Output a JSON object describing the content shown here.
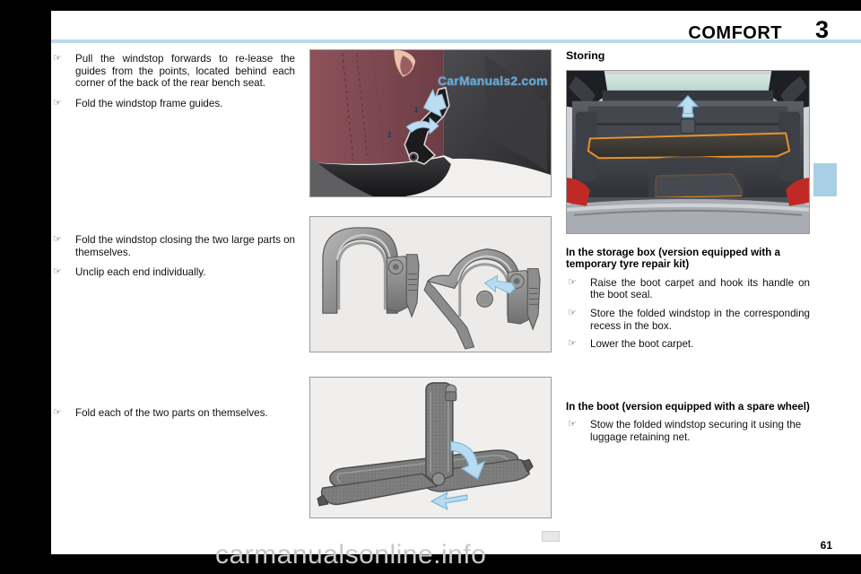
{
  "header": {
    "title": "COMFORT",
    "chapter_number": "3"
  },
  "left_column": {
    "steps_block_1": [
      "Pull the windstop forwards to re-lease the guides from the points, located behind each corner of the back of the rear bench seat.",
      "Fold the windstop frame guides."
    ],
    "steps_block_2": [
      "Fold the windstop closing the two large parts on themselves.",
      "Unclip each end individually."
    ],
    "steps_block_3": [
      "Fold each of the two parts on themselves."
    ]
  },
  "figures": {
    "fig_seat_guide": {
      "caption": "rear seat windstop guide release",
      "watermark": "CarManuals2.com",
      "arrow_labels": [
        "1",
        "2"
      ]
    },
    "fig_frame_unclip": {
      "caption": "windstop frame end unclipping"
    },
    "fig_folded_frame": {
      "caption": "folding the two windstop parts"
    },
    "fig_boot": {
      "caption": "boot with carpet and storage box"
    }
  },
  "right_column": {
    "section_title": "Storing",
    "subsection_1": {
      "title": "In the storage box (version equipped with a temporary tyre repair kit)",
      "steps": [
        "Raise the boot carpet and hook its handle on the boot seal.",
        "Store the folded windstop in the corresponding recess in the box.",
        "Lower the boot carpet."
      ]
    },
    "subsection_2": {
      "title": "In the boot (version equipped with a spare wheel)",
      "steps": [
        "Stow the folded windstop securing it using the luggage retaining net."
      ]
    }
  },
  "footer": {
    "page_number": "61",
    "watermark": "carmanualsonline.info"
  },
  "icons": {
    "bullet_glyph": "☞"
  },
  "colors": {
    "rule": "#bcd9ee",
    "side_tab": "#a9cfe6",
    "arrow": "#b7dbf0",
    "band": "#000000",
    "watermark": "#5aa9dd"
  }
}
